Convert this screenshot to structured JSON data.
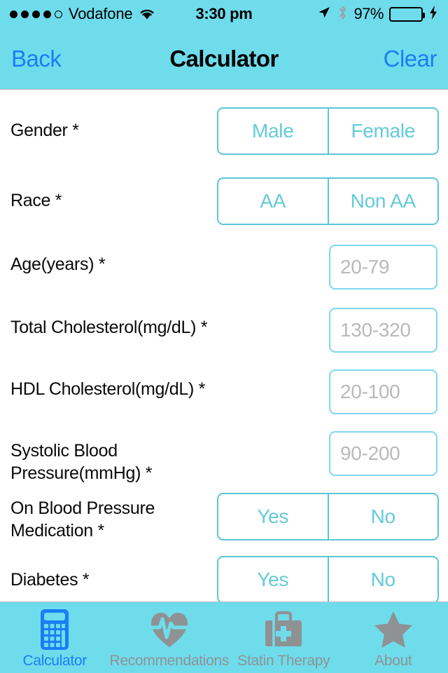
{
  "status_bar": {
    "signal_dots_filled": 4,
    "signal_dots_total": 5,
    "carrier": "Vodafone",
    "wifi_icon": "wifi-icon",
    "time": "3:30 pm",
    "location_icon": "location-arrow-icon",
    "bluetooth_icon": "bluetooth-icon",
    "battery_percent": "97%",
    "battery_level": 97,
    "battery_color": "#4cd964",
    "charging_icon": "lightning-bolt-icon"
  },
  "nav_bar": {
    "back_label": "Back",
    "title": "Calculator",
    "clear_label": "Clear",
    "background": "#6fdcec",
    "link_color": "#1a7ef5"
  },
  "form": {
    "required_marker": "*",
    "rows": [
      {
        "label": "Gender *",
        "type": "segmented",
        "options": [
          "Male",
          "Female"
        ],
        "selected": null
      },
      {
        "label": "Race *",
        "type": "segmented",
        "options": [
          "AA",
          "Non AA"
        ],
        "selected": null
      },
      {
        "label": "Age(years) *",
        "type": "input",
        "value": "",
        "placeholder": "20-79"
      },
      {
        "label": "Total Cholesterol(mg/dL) *",
        "type": "input",
        "value": "",
        "placeholder": "130-320"
      },
      {
        "label": "HDL Cholesterol(mg/dL) *",
        "type": "input",
        "value": "",
        "placeholder": "20-100"
      },
      {
        "label": "Systolic Blood Pressure(mmHg) *",
        "type": "input",
        "value": "",
        "placeholder": "90-200"
      },
      {
        "label": "On Blood Pressure Medication *",
        "type": "segmented",
        "options": [
          "Yes",
          "No"
        ],
        "selected": null
      },
      {
        "label": "Diabetes *",
        "type": "segmented",
        "options": [
          "Yes",
          "No"
        ],
        "selected": null
      }
    ],
    "accent_border": "#5bc6d8",
    "accent_text": "#63cada",
    "placeholder_color": "#b9b9b9"
  },
  "tab_bar": {
    "background": "#6fdcec",
    "active_color": "#1a7ef5",
    "inactive_color": "#8f9293",
    "tabs": [
      {
        "label": "Calculator",
        "icon": "calculator-icon",
        "active": true
      },
      {
        "label": "Recommendations",
        "icon": "heart-pulse-icon",
        "active": false
      },
      {
        "label": "Statin Therapy",
        "icon": "medical-bag-icon",
        "active": false
      },
      {
        "label": "About",
        "icon": "star-icon",
        "active": false
      }
    ]
  }
}
